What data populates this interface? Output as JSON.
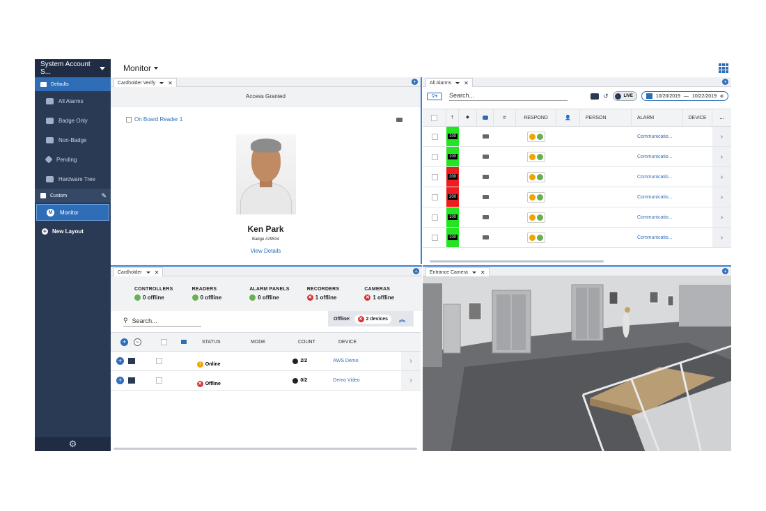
{
  "sidebar": {
    "account": "System Account S...",
    "defaults_label": "Defaults",
    "items": [
      {
        "label": "All Alarms",
        "icon": "alarm-icon"
      },
      {
        "label": "Badge Only",
        "icon": "badge-icon"
      },
      {
        "label": "Non-Badge",
        "icon": "non-badge-icon"
      },
      {
        "label": "Pending",
        "icon": "pending-icon"
      },
      {
        "label": "Hardware Tree",
        "icon": "hardware-tree-icon"
      }
    ],
    "custom_label": "Custom",
    "monitor_label": "Monitor",
    "monitor_letter": "M",
    "new_layout": "New Layout"
  },
  "header": {
    "title": "Monitor"
  },
  "verify": {
    "tab": "Cardholder Verify",
    "status": "Access Granted",
    "reader": "On Board Reader 1",
    "name": "Ken Park",
    "badge": "Badge #29504",
    "view_details": "View Details"
  },
  "alarms": {
    "tab": "All Alarms",
    "search_placeholder": "Search...",
    "live": "LIVE",
    "date_from": "10/20/2019",
    "date_sep": "—",
    "date_to": "10/22/2019",
    "columns": {
      "num": "#",
      "respond": "RESPOND",
      "person": "PERSON",
      "alarm": "ALARM",
      "device": "DEVICE",
      "more": "..."
    },
    "rows": [
      {
        "priority": "100",
        "color": "#22e622",
        "alarm": "Communicatio..."
      },
      {
        "priority": "100",
        "color": "#22e622",
        "alarm": "Communicatio..."
      },
      {
        "priority": "200",
        "color": "#ee1c1c",
        "alarm": "Communicatio..."
      },
      {
        "priority": "200",
        "color": "#ee1c1c",
        "alarm": "Communicatio..."
      },
      {
        "priority": "100",
        "color": "#22e622",
        "alarm": "Communicatio..."
      },
      {
        "priority": "100",
        "color": "#22e622",
        "alarm": "Communicatio..."
      }
    ]
  },
  "cardholder": {
    "tab": "Cardholder",
    "stats": [
      {
        "label": "CONTROLLERS",
        "value": "0 offline",
        "state": "ok"
      },
      {
        "label": "READERS",
        "value": "0 offline",
        "state": "ok"
      },
      {
        "label": "ALARM PANELS",
        "value": "0 offline",
        "state": "ok"
      },
      {
        "label": "RECORDERS",
        "value": "1 offline",
        "state": "error"
      },
      {
        "label": "CAMERAS",
        "value": "1 offline",
        "state": "error"
      }
    ],
    "search_placeholder": "Search...",
    "offline_label": "Offline:",
    "offline_devices": "2 devices",
    "columns": {
      "status": "STATUS",
      "mode": "MODE",
      "count": "COUNT",
      "device": "DEVICE"
    },
    "rows": [
      {
        "status": "Online",
        "count": "2/2",
        "device": "AWS Demo"
      },
      {
        "status": "Offline",
        "count": "0/2",
        "device": "Demo Video"
      }
    ]
  },
  "camera": {
    "tab": "Entrance Camera"
  }
}
